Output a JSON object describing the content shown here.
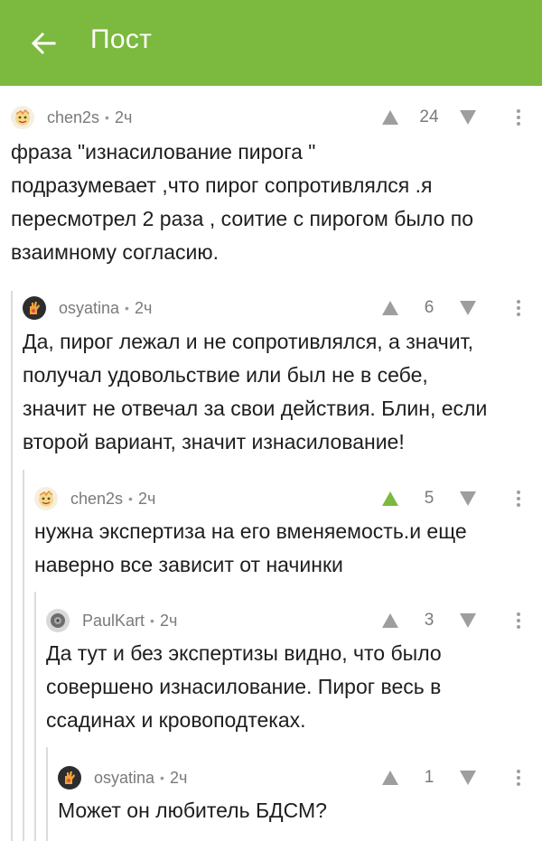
{
  "header": {
    "title": "Пост",
    "back_icon": "arrow-left-icon",
    "background": "#7bb93f"
  },
  "comments": [
    {
      "username": "chen2s",
      "time": "2ч",
      "score": "24",
      "upvoted": false,
      "avatar_icon": "avatar-chen2s",
      "text": "фраза \"изнасилование пирога \"\nподразумевает ,что пирог сопротивлялся .я\nпересмотрел 2 раза , соитие с пирогом было по\nвзаимному согласию."
    },
    {
      "username": "osyatina",
      "time": "2ч",
      "score": "6",
      "upvoted": false,
      "avatar_icon": "avatar-osyatina",
      "text": "Да, пирог лежал и не сопротивлялся, а значит,\nполучал удовольствие или был не в себе,\nзначит не отвечал за свои действия. Блин, если\nвторой вариант, значит изнасилование!"
    },
    {
      "username": "chen2s",
      "time": "2ч",
      "score": "5",
      "upvoted": true,
      "avatar_icon": "avatar-chen2s",
      "text": "нужна экспертиза на его вменяемость.и еще\nнаверно все зависит от начинки"
    },
    {
      "username": "PaulKart",
      "time": "2ч",
      "score": "3",
      "upvoted": false,
      "avatar_icon": "avatar-paulkart",
      "text": "Да тут и без экспертизы видно, что было\nсовершено изнасилование. Пирог весь в\nссадинах и кровоподтеках."
    },
    {
      "username": "osyatina",
      "time": "2ч",
      "score": "1",
      "upvoted": false,
      "avatar_icon": "avatar-osyatina",
      "text": "Может он любитель БДСМ?"
    }
  ],
  "colors": {
    "vote_active": "#7bb93f",
    "vote_inactive": "#9e9e9e"
  }
}
